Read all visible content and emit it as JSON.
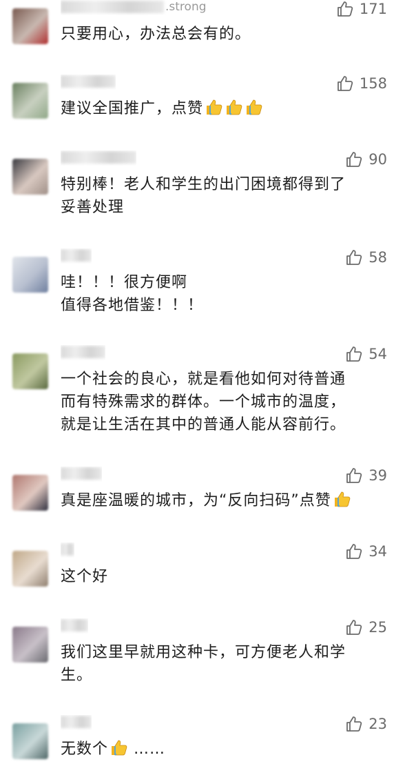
{
  "comments": [
    {
      "nickname": ".strong",
      "likes": "171",
      "text": "只要用心，办法总会有的。",
      "emojis": 0,
      "avatar_colors": [
        "#7a5a50",
        "#c8b8b0",
        "#b03030"
      ]
    },
    {
      "nickname": "",
      "likes": "158",
      "text": "建议全国推广，点赞",
      "emojis": 3,
      "avatar_colors": [
        "#6a8060",
        "#c8d0c0",
        "#90a888"
      ]
    },
    {
      "nickname": "",
      "likes": "90",
      "text": "特别棒！老人和学生的出门困境都得到了\n妥善处理",
      "emojis": 0,
      "avatar_colors": [
        "#3a3a40",
        "#d8c8c0",
        "#a09088"
      ]
    },
    {
      "nickname": "",
      "likes": "58",
      "text": "哇！！！很方便啊\n值得各地借鉴！！！",
      "emojis": 0,
      "avatar_colors": [
        "#e0e4ea",
        "#b8c0d0",
        "#7080a0"
      ]
    },
    {
      "nickname": "",
      "likes": "54",
      "text": "一个社会的良心，就是看他如何对待普通\n而有特殊需求的群体。一个城市的温度，\n就是让生活在其中的普通人能从容前行。",
      "emojis": 0,
      "avatar_colors": [
        "#8a9a60",
        "#c0c8a0",
        "#5a6a40"
      ]
    },
    {
      "nickname": "",
      "likes": "39",
      "text": "真是座温暖的城市，为“反向扫码”点赞",
      "emojis": 1,
      "avatar_colors": [
        "#b07870",
        "#e0c8c0",
        "#303040"
      ]
    },
    {
      "nickname": "",
      "likes": "34",
      "text": "这个好",
      "emojis": 0,
      "avatar_colors": [
        "#c0a888",
        "#e8dcd0",
        "#908070"
      ]
    },
    {
      "nickname": "",
      "likes": "25",
      "text": "我们这里早就用这种卡，可方便老人和学\n生。",
      "emojis": 0,
      "avatar_colors": [
        "#8a7a8a",
        "#c8c0c8",
        "#6a6a70"
      ]
    },
    {
      "nickname": "",
      "likes": "23",
      "text": "无数个",
      "emojis": 1,
      "trailing": " ……",
      "avatar_colors": [
        "#7aa0a0",
        "#c8d8d8",
        "#506868"
      ]
    }
  ]
}
